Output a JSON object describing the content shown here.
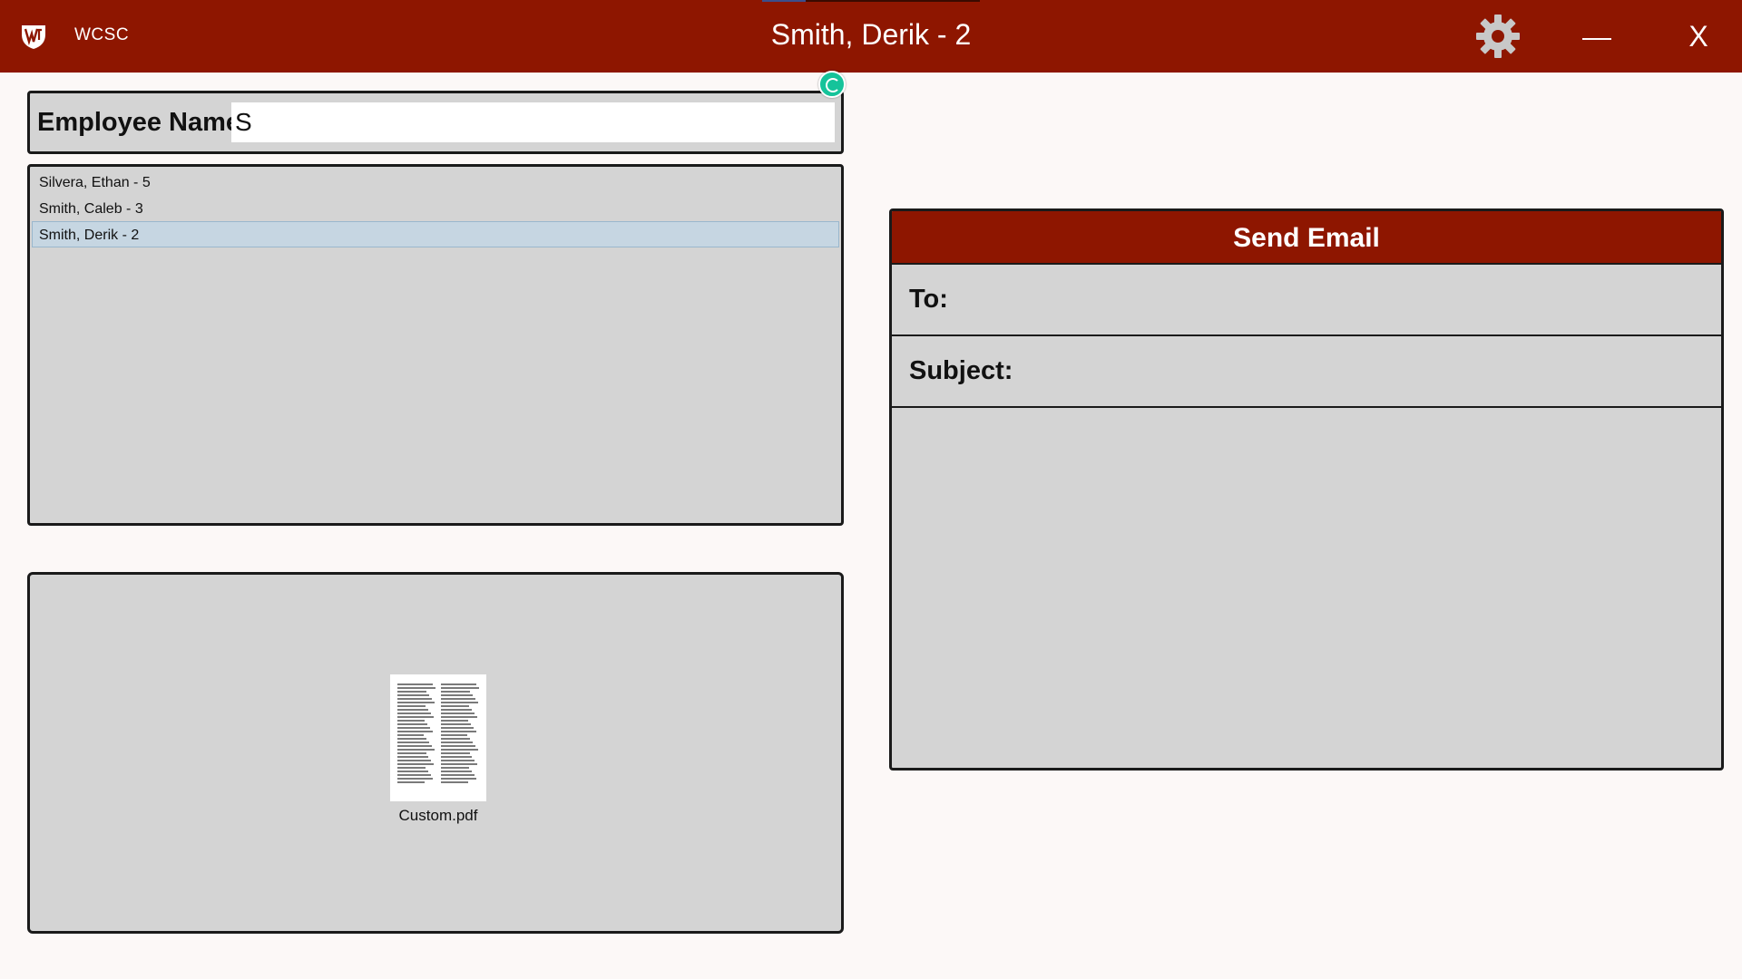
{
  "app": {
    "name": "WCSC",
    "window_title": "Smith, Derik - 2",
    "accent_color": "#8e1600",
    "controls": {
      "settings_icon": "gear-icon",
      "minimize_icon": "minimize-icon",
      "close_label": "X"
    }
  },
  "search": {
    "label": "Employee Name:",
    "value": "S"
  },
  "results": [
    {
      "label": "Silvera, Ethan - 5",
      "selected": false
    },
    {
      "label": "Smith, Caleb - 3",
      "selected": false
    },
    {
      "label": "Smith, Derik - 2",
      "selected": true
    }
  ],
  "attachments": [
    {
      "file_name": "Custom.pdf",
      "icon": "pdf-thumbnail-icon"
    }
  ],
  "email": {
    "title": "Send Email",
    "to_label": "To:",
    "to_value": "",
    "subject_label": "Subject:",
    "subject_value": "",
    "body": ""
  }
}
